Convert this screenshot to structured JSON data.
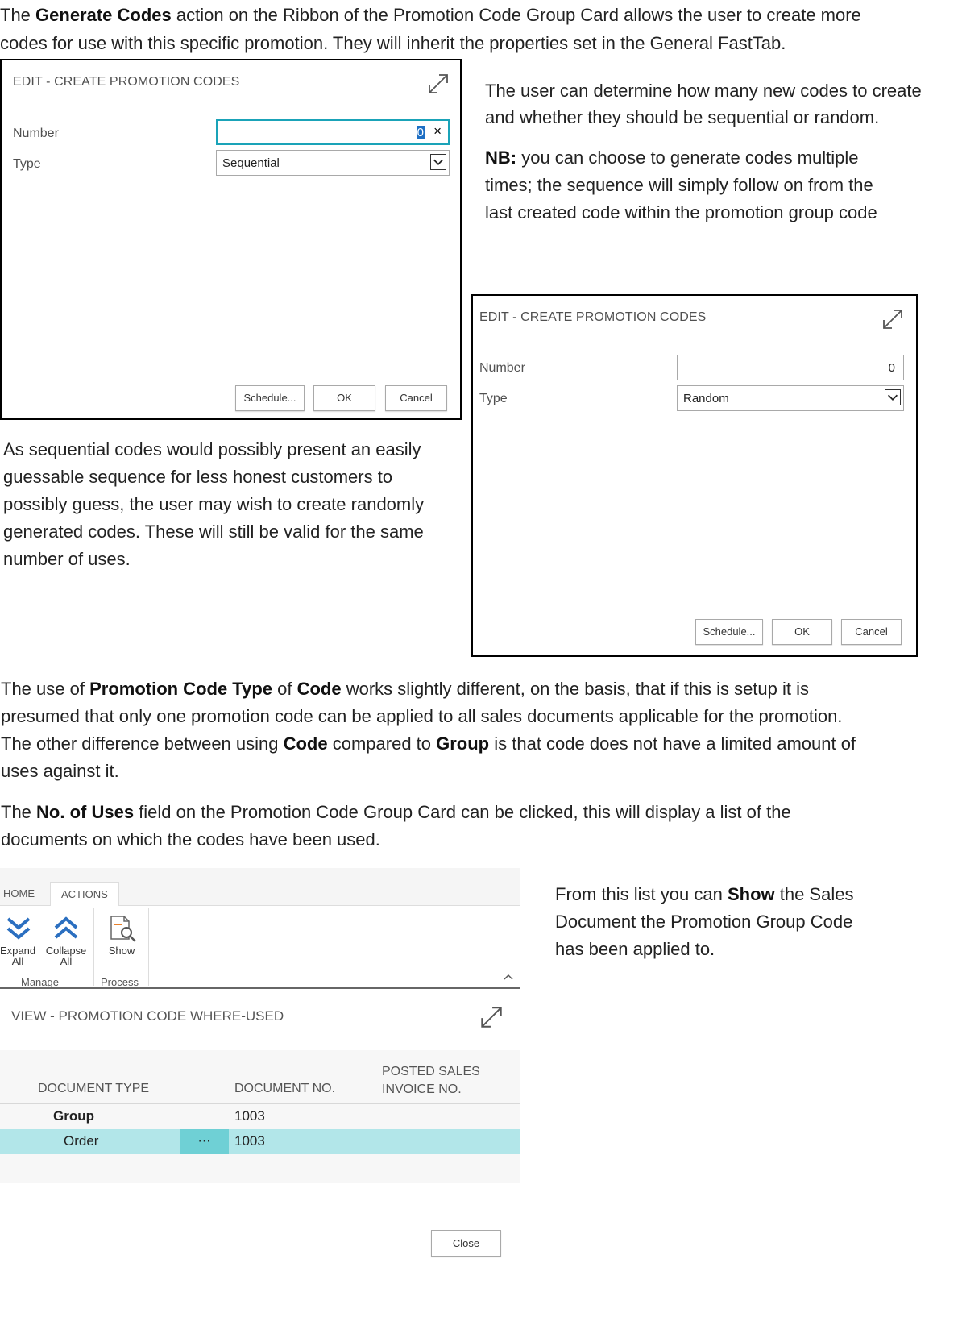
{
  "intro": {
    "line1": {
      "pre": "The ",
      "bold": "Generate Codes",
      "post": " action on the Ribbon of the Promotion Code Group Card allows the user to create more"
    },
    "line2": "codes for use with this specific promotion. They will inherit the properties set in the General FastTab."
  },
  "dialog1": {
    "title": "EDIT - CREATE PROMOTION CODES",
    "number_label": "Number",
    "number_value": "0",
    "clear_icon": "×",
    "type_label": "Type",
    "type_value": "Sequential",
    "schedule_label": "Schedule...",
    "ok_label": "OK",
    "cancel_label": "Cancel"
  },
  "right_text": {
    "p1_l1": "The user can determine how many new codes to create",
    "p1_l2": "and whether they should be sequential or random.",
    "p2_bold": "NB:",
    "p2_l1_rest": " you can choose to generate codes multiple",
    "p2_l2": "times; the sequence will simply follow on from the",
    "p2_l3": "last created code within the promotion group code"
  },
  "dialog2": {
    "title": "EDIT - CREATE PROMOTION CODES",
    "number_label": "Number",
    "number_value": "0",
    "type_label": "Type",
    "type_value": "Random",
    "schedule_label": "Schedule...",
    "ok_label": "OK",
    "cancel_label": "Cancel"
  },
  "left_text": {
    "l1": "As sequential codes would possibly present an easily",
    "l2": "guessable sequence for less honest customers to",
    "l3": "possibly guess, the user may wish to create randomly",
    "l4": "generated codes. These will still be valid for the same",
    "l5": "number of uses."
  },
  "mid_text": {
    "l1_a": "The use of ",
    "l1_b": "Promotion Code Type",
    "l1_c": " of ",
    "l1_d": "Code",
    "l1_e": " works slightly different, on the basis, that if this is setup it is",
    "l2": "presumed that only one promotion code can be applied to all sales documents applicable for the promotion.",
    "l3_a": "The other difference between using ",
    "l3_b": "Code",
    "l3_c": " compared to ",
    "l3_d": "Group",
    "l3_e": " is that code does not have a limited amount of",
    "l4": "uses against it.",
    "l5_a": "The ",
    "l5_b": "No. of Uses",
    "l5_c": " field on the Promotion Code Group Card can be clicked, this will display a list of the",
    "l6": "documents on which the codes have been used."
  },
  "ribbon": {
    "tab_home": "HOME",
    "tab_actions": "ACTIONS",
    "expand_l1": "Expand",
    "expand_l2": "All",
    "collapse_l1": "Collapse",
    "collapse_l2": "All",
    "show": "Show",
    "group_manage": "Manage",
    "group_process": "Process"
  },
  "where_used": {
    "title": "VIEW - PROMOTION CODE WHERE-USED",
    "col_doc_type": "DOCUMENT TYPE",
    "col_doc_no": "DOCUMENT NO.",
    "col_posted_l1": "POSTED SALES",
    "col_posted_l2": "INVOICE NO.",
    "rows": [
      {
        "doc_type": "Group",
        "doc_no": "1003"
      },
      {
        "doc_type": "Order",
        "menu": "···",
        "doc_no": "1003"
      }
    ],
    "close_label": "Close"
  },
  "side_text": {
    "l1_a": "From this list you can ",
    "l1_b": "Show",
    "l1_c": " the Sales",
    "l2": "Document the Promotion Group Code",
    "l3": "has been applied to."
  },
  "colors": {
    "accent_focus": "#1aa3b8",
    "selected_row": "#b2e6e9",
    "row_menu": "#6fd0d5"
  }
}
